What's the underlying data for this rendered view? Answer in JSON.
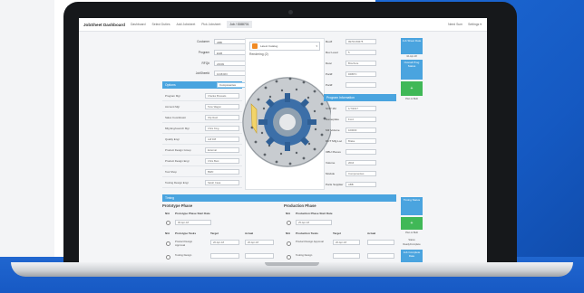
{
  "app": {
    "title": "JobSheet Dashboard",
    "nav": [
      "Dashboard",
      "Select Duties",
      "Add Jobsheet",
      "Pick Jobsheet",
      "Job / ID88701"
    ],
    "nav_active_index": 4,
    "nav_right": [
      "Need Sum",
      "Settings ▾"
    ]
  },
  "left_form": [
    {
      "label": "Customer",
      "value": "ABB"
    },
    {
      "label": "Program",
      "value": "EGB"
    },
    {
      "label": "RFQ#",
      "value": "24049"
    },
    {
      "label": "JobSheet#",
      "value": "1048 RFI"
    }
  ],
  "options_panel": {
    "title": "Options",
    "select_value": "Componentes",
    "rows": [
      {
        "label": "Program Mgr",
        "value": "Charles Brussels"
      },
      {
        "label": "Account Mgr",
        "value": "Tanu Wagon"
      },
      {
        "label": "Sales Coordinator",
        "value": "Olly Reid"
      },
      {
        "label": "Mfg Eng/Launch Mgr",
        "value": "Chris King"
      },
      {
        "label": "Quality Engr",
        "value": "Jeff Diff"
      },
      {
        "label": "Product Design Group",
        "value": "External"
      },
      {
        "label": "Product Design Engr",
        "value": "Chris Bust"
      },
      {
        "label": "Tool Shop",
        "value": "BWD"
      },
      {
        "label": "Tooling Design Engr",
        "value": "Sarah Casa"
      }
    ]
  },
  "image_panel": {
    "dropdown": "Latest Catalog",
    "caption": "Rendering (2)"
  },
  "right_form": [
    {
      "label": "Rev#",
      "value": "99700 80675"
    },
    {
      "label": "Rev Level",
      "value": "5"
    },
    {
      "label": "Desc",
      "value": "Brochure"
    },
    {
      "label": "Part#",
      "value": "DDB7C"
    },
    {
      "label": "Part#",
      "value": ""
    }
  ],
  "program_info": {
    "title": "Program Information",
    "rows": [
      {
        "label": "SOP 1M",
        "value": "1/7/2017"
      },
      {
        "label": "Nameplate",
        "value": "Ford"
      },
      {
        "label": "Mfr Volume",
        "value": "100000"
      },
      {
        "label": "DCT Mfg Loc",
        "value": "Brake"
      },
      {
        "label": "OBU Pieces",
        "value": ""
      },
      {
        "label": "Volume",
        "value": "2016"
      },
      {
        "label": "Module",
        "value": "Componentes"
      },
      {
        "label": "Parts Supplier",
        "value": "ABB"
      }
    ]
  },
  "side_buttons": {
    "job_sheet": "Job Sheet Date",
    "job_sheet_date": "10-Apr-18",
    "overall_prog": "Overall Prog Status",
    "add_symbol": "+",
    "add_caption": "Plan to Built",
    "timing_status": "Timing Status",
    "add_caption_2": "Plan to Built",
    "status_note": "Status",
    "status_sub": "Ready/Complete",
    "complete_date": "Job Complete Date"
  },
  "timing": {
    "title": "Timing",
    "prototype": {
      "title": "Prototype Phase",
      "start_header": [
        "N/A",
        "Prototype Phase Start Date"
      ],
      "start_value": "06-Apr-18",
      "headers": [
        "N/A",
        "Prototype Tasks",
        "Target",
        "Actual"
      ],
      "rows": [
        {
          "task": "Product Design Approval",
          "target": "20-Apr-18",
          "actual": "20-Apr-18"
        },
        {
          "task": "Tooling Design",
          "target": "",
          "actual": ""
        }
      ]
    },
    "production": {
      "title": "Production Phase",
      "start_header": [
        "N/A",
        "Production Phase Start Date"
      ],
      "start_value": "25-Apr-18",
      "headers": [
        "N/A",
        "Production Tasks",
        "Target",
        "Actual"
      ],
      "rows": [
        {
          "task": "Product Design Approval",
          "target": "20-Apr-18",
          "actual": ""
        },
        {
          "task": "Tooling Design",
          "target": "",
          "actual": ""
        }
      ]
    }
  },
  "colors": {
    "accent": "#4aa4df",
    "success": "#40b857",
    "background_blue": "#1d6ad6"
  }
}
